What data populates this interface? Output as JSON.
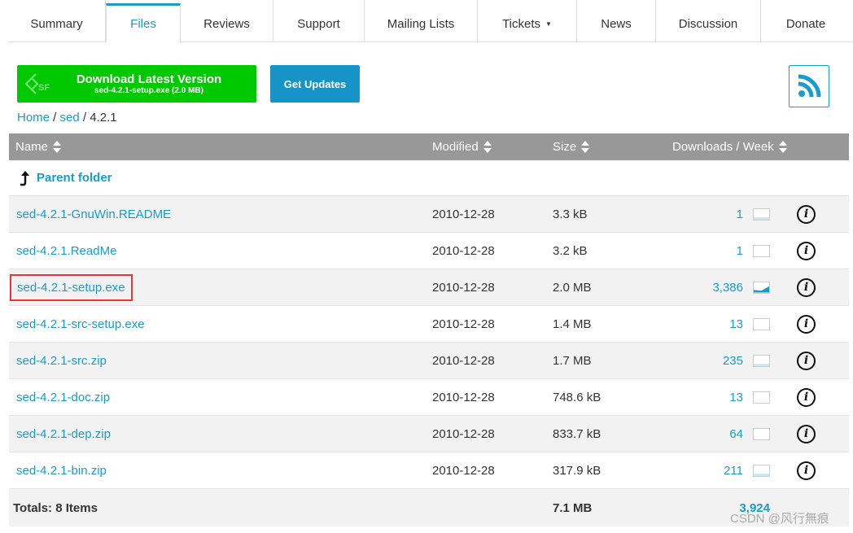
{
  "tabs": [
    {
      "label": "Summary"
    },
    {
      "label": "Files"
    },
    {
      "label": "Reviews"
    },
    {
      "label": "Support"
    },
    {
      "label": "Mailing Lists"
    },
    {
      "label": "Tickets"
    },
    {
      "label": "News"
    },
    {
      "label": "Discussion"
    },
    {
      "label": "Donate"
    }
  ],
  "active_tab": "Files",
  "download": {
    "title": "Download Latest Version",
    "subtitle": "sed-4.2.1-setup.exe (2.0 MB)",
    "logo_text": "SF"
  },
  "get_updates_label": "Get Updates",
  "breadcrumb": {
    "home": "Home",
    "sep1": " / ",
    "project": "sed",
    "sep2": " / ",
    "current": "4.2.1"
  },
  "table": {
    "headers": {
      "name": "Name",
      "modified": "Modified",
      "size": "Size",
      "downloads": "Downloads / Week"
    },
    "parent_folder": "Parent folder",
    "rows": [
      {
        "name": "sed-4.2.1-GnuWin.README",
        "modified": "2010-12-28",
        "size": "3.3 kB",
        "downloads": "1"
      },
      {
        "name": "sed-4.2.1.ReadMe",
        "modified": "2010-12-28",
        "size": "3.2 kB",
        "downloads": "1"
      },
      {
        "name": "sed-4.2.1-setup.exe",
        "modified": "2010-12-28",
        "size": "2.0 MB",
        "downloads": "3,386"
      },
      {
        "name": "sed-4.2.1-src-setup.exe",
        "modified": "2010-12-28",
        "size": "1.4 MB",
        "downloads": "13"
      },
      {
        "name": "sed-4.2.1-src.zip",
        "modified": "2010-12-28",
        "size": "1.7 MB",
        "downloads": "235"
      },
      {
        "name": "sed-4.2.1-doc.zip",
        "modified": "2010-12-28",
        "size": "748.6 kB",
        "downloads": "13"
      },
      {
        "name": "sed-4.2.1-dep.zip",
        "modified": "2010-12-28",
        "size": "833.7 kB",
        "downloads": "64"
      },
      {
        "name": "sed-4.2.1-bin.zip",
        "modified": "2010-12-28",
        "size": "317.9 kB",
        "downloads": "211"
      }
    ],
    "totals": {
      "label": "Totals: 8 Items",
      "size": "7.1 MB",
      "downloads": "3,924"
    }
  },
  "watermark": "CSDN @风行無痕",
  "colors": {
    "accent": "#1a9cc9",
    "download_green": "#00c900",
    "updates_blue": "#1693c7",
    "header_gray": "#989898",
    "highlight_red": "#e03a3a"
  }
}
